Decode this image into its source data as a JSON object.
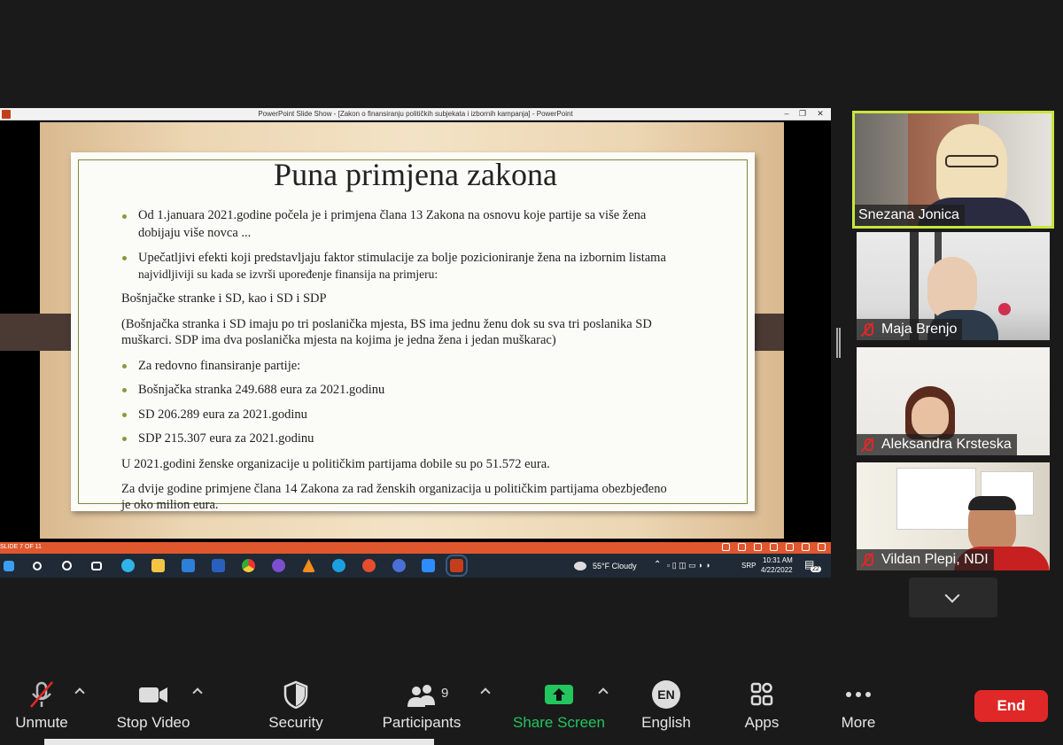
{
  "ppt": {
    "window_title": "PowerPoint Slide Show - [Zakon o finansiranju političkih subjekata i izbornih kampanja] - PowerPoint",
    "slide_counter": "SLIDE 7 OF 11"
  },
  "slide": {
    "title": "Puna primjena zakona",
    "bullet1_line1": "Od 1.januara 2021.godine počela je i primjena člana 13 Zakona na osnovu koje partije sa više žena",
    "bullet1_line2": "dobijaju više novca ...",
    "bullet2_line1": "Upečatljivi efekti koji predstavljaju faktor stimulacije za bolje pozicioniranje žena na izbornim listama",
    "bullet2_line2": "najvidljiviji su kada se izvrši upoređenje finansija na primjeru:",
    "para1": "Bošnjačke stranke i SD, kao i SD i SDP",
    "para2_line1": "(Bošnjačka stranka i SD imaju po tri poslanička mjesta, BS ima jednu ženu dok su sva tri poslanika SD",
    "para2_line2": "muškarci. SDP ima dva poslanička mjesta na kojima je jedna žena i jedan muškarac)",
    "bullet3": "Za redovno finansiranje partije:",
    "bullet4": "Bošnjačka stranka 249.688 eura za 2021.godinu",
    "bullet5": "SD 206.289 eura za 2021.godinu",
    "bullet6": "SDP 215.307 eura za 2021.godinu",
    "para3": "U 2021.godini ženske organizacije u političkim partijama dobile su po 51.572 eura.",
    "para4_line1": "Za dvije godine primjene člana 14 Zakona za rad ženskih organizacija u političkim partijama obezbjeđeno",
    "para4_line2": "je oko milion eura."
  },
  "taskbar": {
    "weather": "55°F  Cloudy",
    "lang": "SRP",
    "time": "10:31 AM",
    "date": "4/22/2022",
    "notif_count": "22"
  },
  "participants": [
    {
      "name": "Snezana Jonica",
      "muted": false
    },
    {
      "name": "Maja Brenjo",
      "muted": true
    },
    {
      "name": "Aleksandra Krsteska",
      "muted": true
    },
    {
      "name": "Vildan Plepi, NDI",
      "muted": true
    }
  ],
  "toolbar": {
    "unmute": "Unmute",
    "stop_video": "Stop Video",
    "security": "Security",
    "participants": "Participants",
    "participants_count": "9",
    "share_screen": "Share Screen",
    "english": "English",
    "english_badge": "EN",
    "apps": "Apps",
    "more": "More",
    "end": "End"
  },
  "colors": {
    "active_speaker_border": "#c8e63c",
    "share_green": "#22c55e",
    "end_red": "#e02828",
    "ppt_orange": "#e0572e"
  }
}
